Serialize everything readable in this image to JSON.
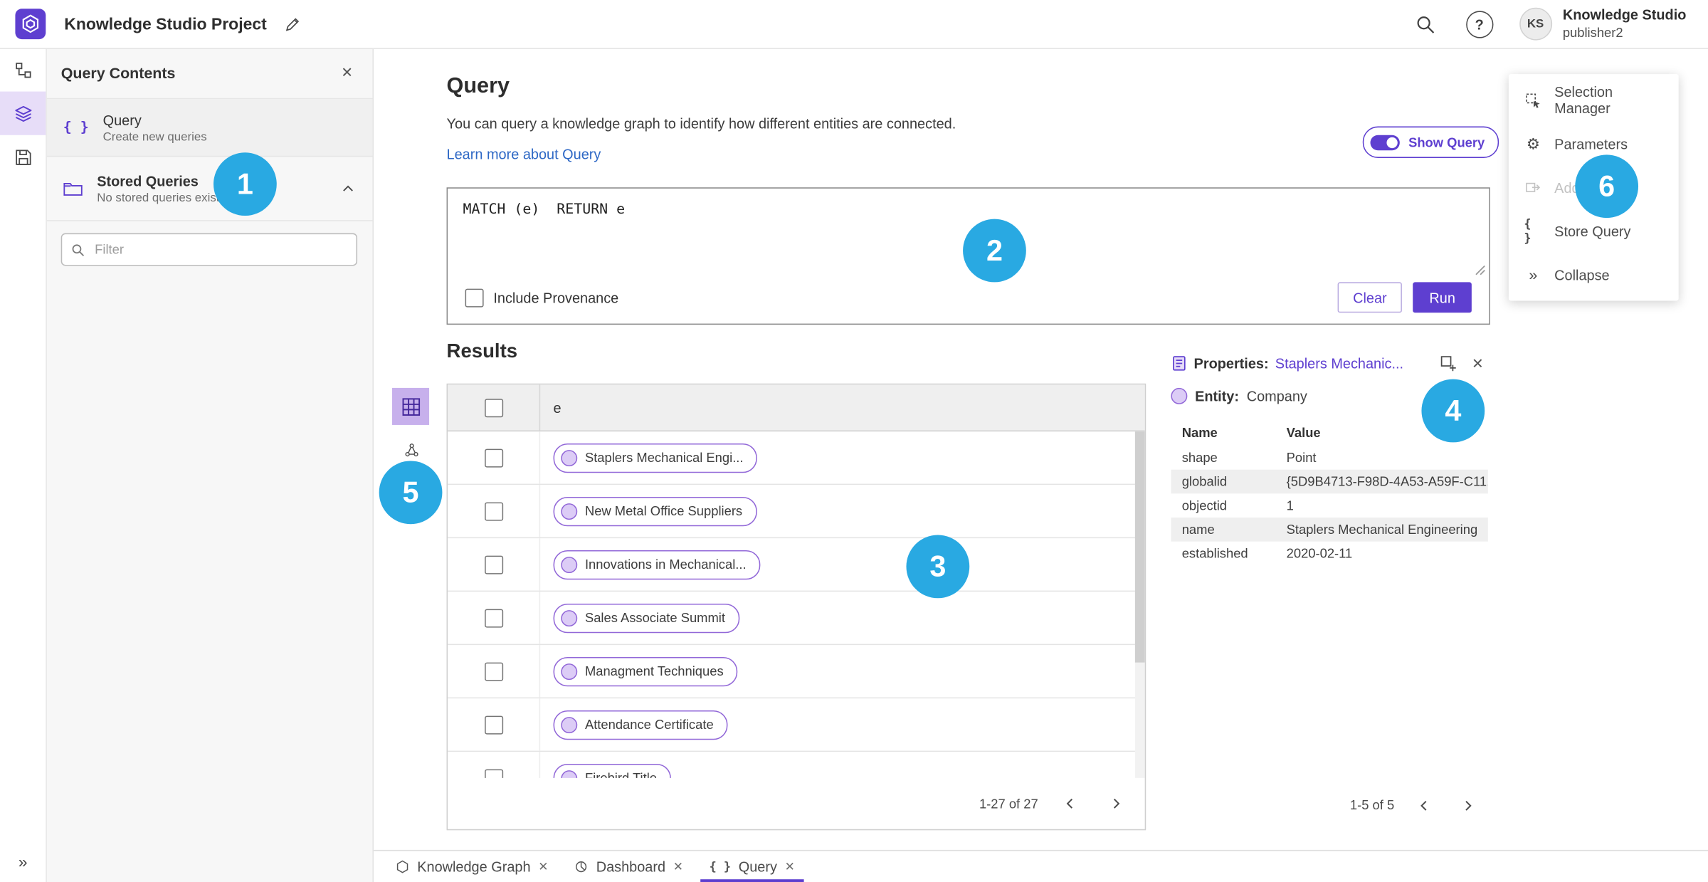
{
  "colors": {
    "accent": "#5e3fd0",
    "accent_light": "#e7ddf8",
    "badge_blue": "#29a9e2",
    "link_blue": "#2e68c5"
  },
  "icons": {
    "close": "✕",
    "collapse": "»",
    "braces": "{ }",
    "help": "?",
    "gear": "⚙"
  },
  "topbar": {
    "title": "Knowledge Studio Project",
    "account": {
      "initials": "KS",
      "org": "Knowledge Studio",
      "user": "publisher2"
    }
  },
  "query_contents": {
    "title": "Query Contents",
    "query_item": {
      "label": "Query",
      "description": "Create new queries"
    },
    "stored_item": {
      "label": "Stored Queries",
      "description": "No stored queries exist"
    },
    "filter_placeholder": "Filter"
  },
  "query_panel": {
    "heading": "Query",
    "description": "You can query a knowledge graph to identify how different entities are connected.",
    "learn_more": "Learn more about Query",
    "show_query": "Show Query",
    "code": "MATCH (e)  RETURN e",
    "include_provenance": "Include Provenance",
    "clear": "Clear",
    "run": "Run"
  },
  "results": {
    "heading": "Results",
    "column": "e",
    "rows": [
      "Staplers Mechanical Engi...",
      "New Metal Office Suppliers",
      "Innovations in Mechanical...",
      "Sales Associate Summit",
      "Managment Techniques",
      "Attendance Certificate",
      "Firebird Title"
    ],
    "pagination": "1-27 of 27"
  },
  "properties": {
    "label": "Properties:",
    "link": "Staplers Mechanic...",
    "entity_label": "Entity:",
    "entity_value": "Company",
    "col_name": "Name",
    "col_value": "Value",
    "rows": [
      {
        "name": "shape",
        "value": "Point"
      },
      {
        "name": "globalid",
        "value": "{5D9B4713-F98D-4A53-A59F-C11..."
      },
      {
        "name": "objectid",
        "value": "1"
      },
      {
        "name": "name",
        "value": "Staplers Mechanical Engineering"
      },
      {
        "name": "established",
        "value": "2020-02-11"
      }
    ],
    "pagination": "1-5 of 5"
  },
  "side_menu": {
    "items": [
      {
        "label": "Selection Manager"
      },
      {
        "label": "Parameters"
      },
      {
        "label": "Add To...",
        "disabled": true
      },
      {
        "label": "Store Query"
      },
      {
        "label": "Collapse"
      }
    ]
  },
  "tabs": [
    {
      "label": "Knowledge Graph"
    },
    {
      "label": "Dashboard"
    },
    {
      "label": "Query",
      "active": true
    }
  ],
  "annotations": [
    "1",
    "2",
    "3",
    "4",
    "5",
    "6"
  ]
}
